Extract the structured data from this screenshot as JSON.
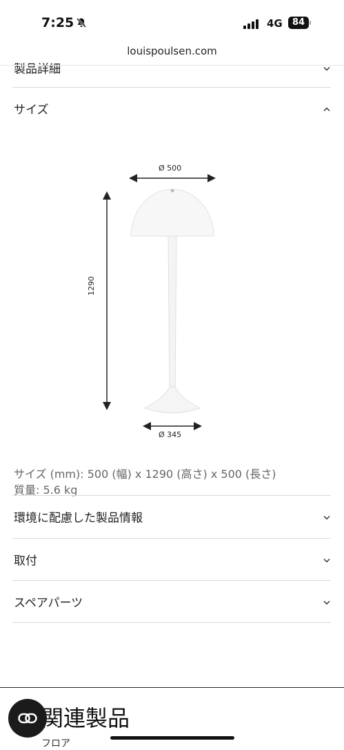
{
  "status_bar": {
    "time": "7:25",
    "network": "4G",
    "battery": "84"
  },
  "browser": {
    "url": "louispoulsen.com"
  },
  "accordion": {
    "product_details": "製品詳細",
    "size": "サイズ",
    "environment": "環境に配慮した製品情報",
    "mounting": "取付",
    "spare_parts": "スペアパーツ"
  },
  "diagram": {
    "top_width": "Ø 500",
    "height": "1290",
    "base_width": "Ø 345"
  },
  "specs": {
    "size_line": "サイズ (mm): 500 (幅) x 1290 (高さ) x 500 (長さ)",
    "weight_line": "質量: 5.6 kg"
  },
  "related": {
    "title": "関連製品",
    "subtitle": "フロア"
  },
  "icons": [
    "bell-slash-icon",
    "signal-icon",
    "chevron-down-icon",
    "chevron-up-icon",
    "co-icon"
  ]
}
